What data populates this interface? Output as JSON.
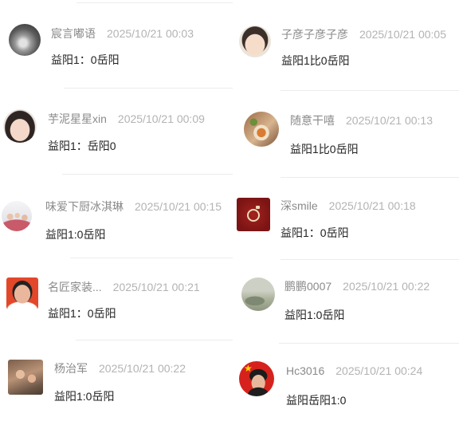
{
  "colors": {
    "name": "#8a8a8a",
    "time": "#b3b3b3",
    "text": "#222222",
    "divider": "#ececec"
  },
  "left_column": {
    "comments": [
      {
        "name": "宸言嘟语",
        "time": "2025/10/21 00:03",
        "text": "益阳1：0岳阳"
      },
      {
        "name": "芋泥星星xin",
        "time": "2025/10/21 00:09",
        "text": "益阳1：岳阳0"
      },
      {
        "name": "味爱下厨冰淇琳",
        "time": "2025/10/21 00:15",
        "text": "益阳1:0岳阳"
      },
      {
        "name": "名匠家装...",
        "time": "2025/10/21 00:21",
        "text": "益阳1：0岳阳"
      },
      {
        "name": "杨治军",
        "time": "2025/10/21 00:22",
        "text": "益阳1:0岳阳"
      }
    ]
  },
  "right_column": {
    "comments": [
      {
        "name": "子彦子彦子彦",
        "time": "2025/10/21 00:05",
        "text": "益阳1比0岳阳"
      },
      {
        "name": "随意干嘻",
        "time": "2025/10/21 00:13",
        "text": "益阳1比0岳阳"
      },
      {
        "name": "深smile",
        "time": "2025/10/21 00:18",
        "text": "益阳1：0岳阳"
      },
      {
        "name": "鹏鹏0007",
        "time": "2025/10/21 00:22",
        "text": "益阳1:0岳阳"
      },
      {
        "name": "Hc3016",
        "time": "2025/10/21 00:24",
        "text": "益阳岳阳1:0"
      }
    ]
  }
}
